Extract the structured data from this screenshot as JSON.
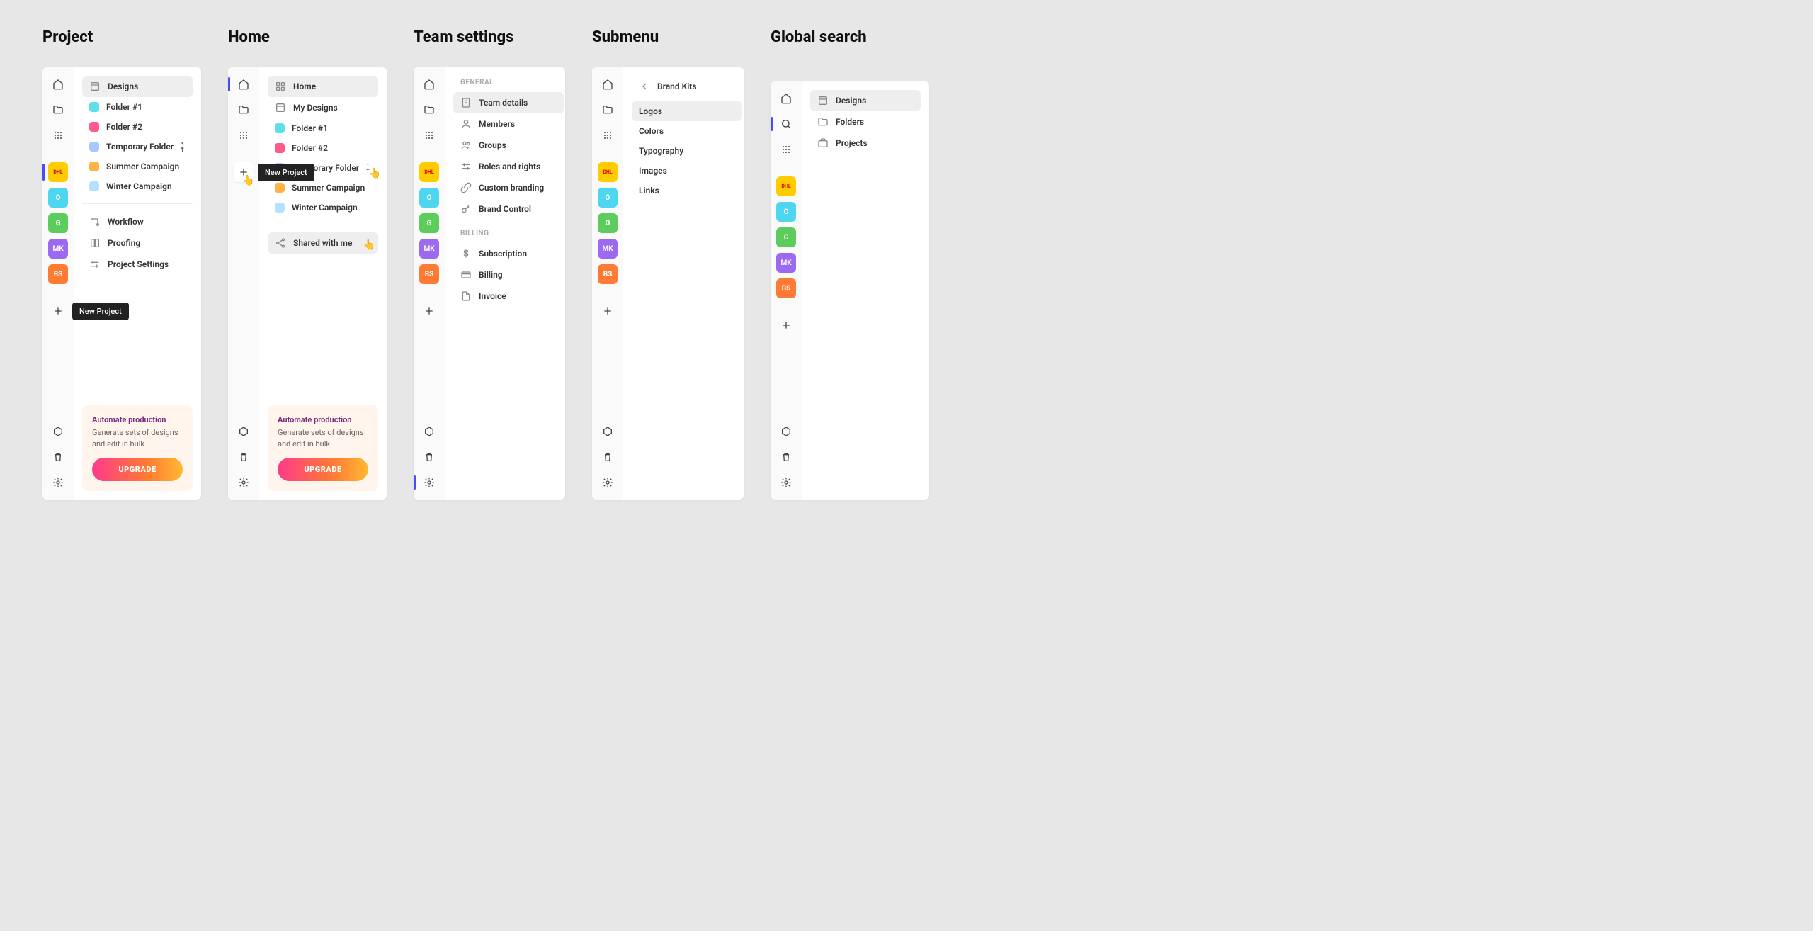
{
  "columns": {
    "project": {
      "title": "Project"
    },
    "home": {
      "title": "Home"
    },
    "team": {
      "title": "Team settings"
    },
    "submenu": {
      "title": "Submenu"
    },
    "search": {
      "title": "Global search"
    }
  },
  "tooltip_new_project": "New Project",
  "project": {
    "items": [
      {
        "label": "Designs"
      },
      {
        "label": "Folder #1",
        "color": "#5de0e6"
      },
      {
        "label": "Folder #2",
        "color": "#ff5a8c"
      },
      {
        "label": "Temporary Folder",
        "color": "#a7c8ff",
        "pinned": true
      },
      {
        "label": "Summer Campaign",
        "color": "#ffb347"
      },
      {
        "label": "Winter Campaign",
        "color": "#b5e0ff"
      }
    ],
    "actions": [
      {
        "label": "Workflow"
      },
      {
        "label": "Proofing"
      },
      {
        "label": "Project Settings"
      }
    ]
  },
  "home": {
    "items": [
      {
        "label": "Home"
      },
      {
        "label": "My Designs"
      },
      {
        "label": "Folder #1",
        "color": "#5de0e6"
      },
      {
        "label": "Folder #2",
        "color": "#ff5a8c"
      },
      {
        "label": "Temporary Folder",
        "color": "#a7c8ff",
        "pin_hover": true
      },
      {
        "label": "Summer Campaign",
        "color": "#ffb347"
      },
      {
        "label": "Winter Campaign",
        "color": "#b5e0ff"
      }
    ],
    "shared": "Shared with me"
  },
  "team": {
    "general_label": "GENERAL",
    "general": [
      {
        "label": "Team details"
      },
      {
        "label": "Members"
      },
      {
        "label": "Groups"
      },
      {
        "label": "Roles and rights"
      },
      {
        "label": "Custom branding"
      },
      {
        "label": "Brand Control"
      }
    ],
    "billing_label": "BILLING",
    "billing": [
      {
        "label": "Subscription"
      },
      {
        "label": "Billing"
      },
      {
        "label": "Invoice"
      }
    ]
  },
  "submenu": {
    "back": "Brand Kits",
    "items": [
      {
        "label": "Logos"
      },
      {
        "label": "Colors"
      },
      {
        "label": "Typography"
      },
      {
        "label": "Images"
      },
      {
        "label": "Links"
      }
    ]
  },
  "search": {
    "items": [
      {
        "label": "Designs"
      },
      {
        "label": "Folders"
      },
      {
        "label": "Projects"
      }
    ]
  },
  "promo": {
    "title": "Automate production",
    "text": "Generate sets of designs and edit in bulk",
    "cta": "UPGRADE"
  },
  "avatars": {
    "dhl": "DHL",
    "o": "O",
    "g": "G",
    "mk": "MK",
    "bs": "BS"
  }
}
